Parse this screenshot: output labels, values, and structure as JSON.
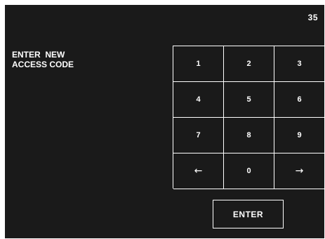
{
  "page_number": "35",
  "prompt": {
    "line1": "ENTER  NEW",
    "line2": "ACCESS CODE"
  },
  "keypad": {
    "keys": [
      {
        "label": "1",
        "name": "key-1"
      },
      {
        "label": "2",
        "name": "key-2"
      },
      {
        "label": "3",
        "name": "key-3"
      },
      {
        "label": "4",
        "name": "key-4"
      },
      {
        "label": "5",
        "name": "key-5"
      },
      {
        "label": "6",
        "name": "key-6"
      },
      {
        "label": "7",
        "name": "key-7"
      },
      {
        "label": "8",
        "name": "key-8"
      },
      {
        "label": "9",
        "name": "key-9"
      },
      {
        "label": "←",
        "name": "key-backspace",
        "icon": "left-arrow-icon"
      },
      {
        "label": "0",
        "name": "key-0"
      },
      {
        "label": "→",
        "name": "key-forward",
        "icon": "right-arrow-icon"
      }
    ]
  },
  "enter_button": {
    "label": "ENTER"
  },
  "colors": {
    "background": "#1a1a1a",
    "foreground": "#ffffff"
  }
}
